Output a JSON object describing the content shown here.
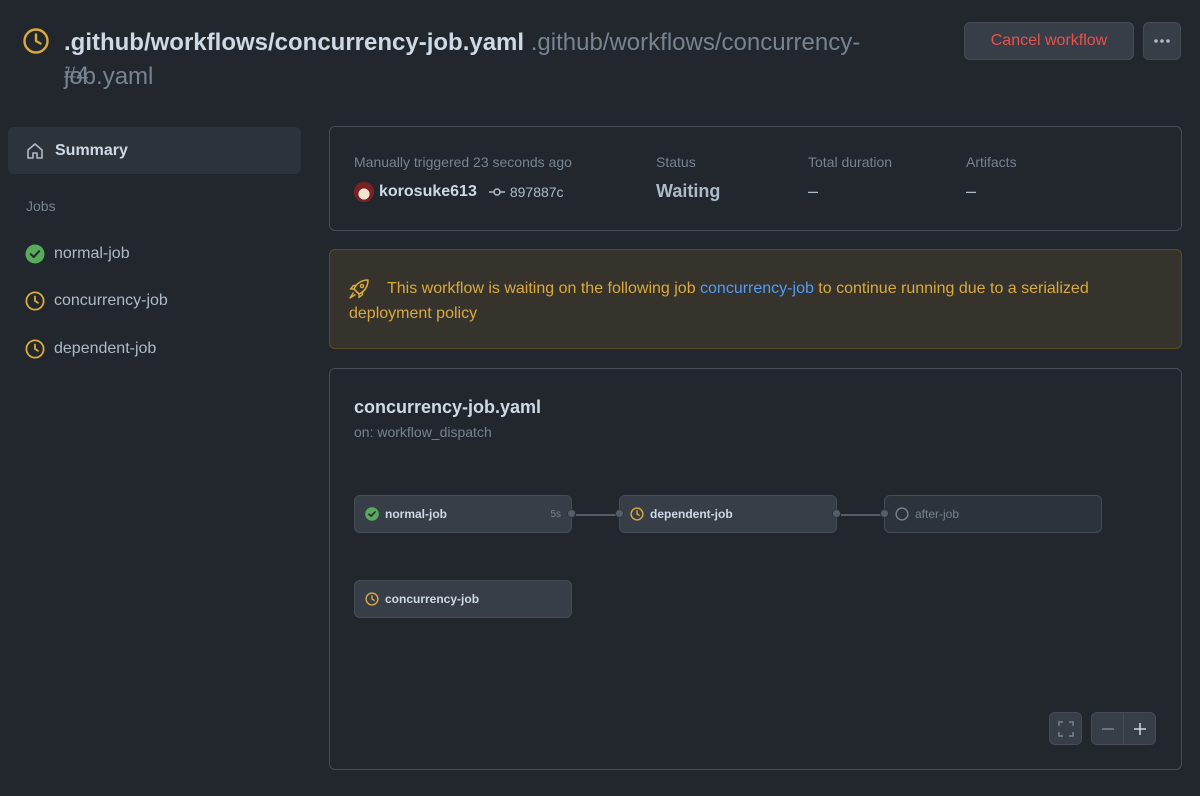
{
  "header": {
    "title_bold": ".github/workflows/concurrency-job.yaml",
    "title_path": ".github/workflows/concurrency-job.yaml",
    "run_number": "#4",
    "cancel_label": "Cancel workflow",
    "more_icon": "kebab-horizontal-icon"
  },
  "sidebar": {
    "summary_label": "Summary",
    "jobs_heading": "Jobs",
    "jobs": [
      {
        "label": "normal-job",
        "status": "success"
      },
      {
        "label": "concurrency-job",
        "status": "waiting"
      },
      {
        "label": "dependent-job",
        "status": "waiting"
      }
    ]
  },
  "summary": {
    "trigger_label": "Manually triggered 23 seconds ago",
    "actor": "korosuke613",
    "commit": "897887c",
    "status_label": "Status",
    "status_value": "Waiting",
    "duration_label": "Total duration",
    "duration_value": "–",
    "artifacts_label": "Artifacts",
    "artifacts_value": "–"
  },
  "flash": {
    "text_before": "This workflow is waiting on the following job ",
    "link": "concurrency-job",
    "text_after": " to continue running due to a serialized deployment policy"
  },
  "graph": {
    "title": "concurrency-job.yaml",
    "subtitle": "on: workflow_dispatch",
    "nodes": {
      "normal": {
        "label": "normal-job",
        "duration": "5s",
        "status": "success"
      },
      "dependent": {
        "label": "dependent-job",
        "status": "waiting"
      },
      "after": {
        "label": "after-job",
        "status": "pending"
      },
      "concurrency": {
        "label": "concurrency-job",
        "status": "waiting"
      }
    }
  },
  "colors": {
    "background": "#22272e",
    "success": "#57ab5a",
    "waiting": "#daaa3f",
    "danger": "#e5534b",
    "link": "#539bf5"
  }
}
